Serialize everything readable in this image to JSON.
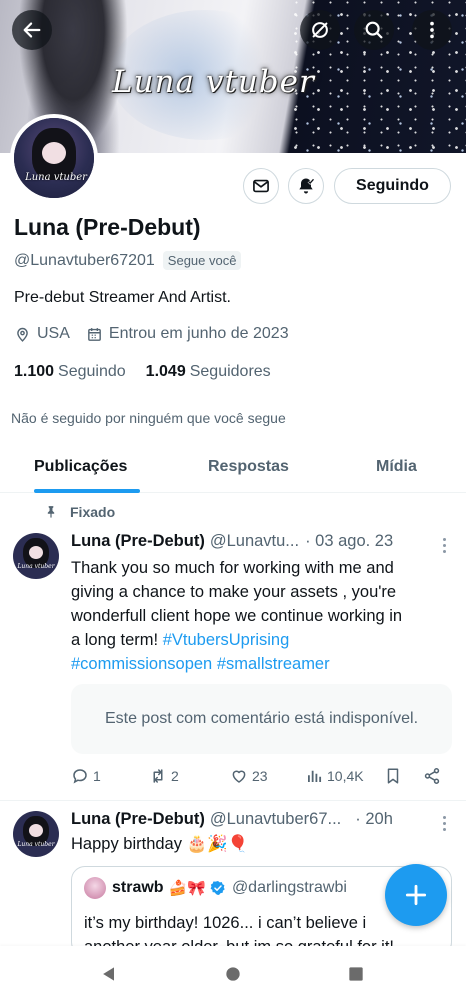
{
  "banner": {
    "title": "Luna vtuber"
  },
  "profile": {
    "name": "Luna (Pre-Debut)",
    "handle": "@Lunavtuber67201",
    "follows_you": "Segue você",
    "bio": "Pre-debut Streamer And Artist.",
    "location": "USA",
    "joined": "Entrou em junho de 2023",
    "following_count": "1.100",
    "following_label": "Seguindo",
    "followers_count": "1.049",
    "followers_label": "Seguidores",
    "not_followed_note": "Não é seguido por ninguém que você segue",
    "follow_button": "Seguindo",
    "avatar_text": "Luna vtuber"
  },
  "tabs": [
    {
      "label": "Publicações",
      "active": true
    },
    {
      "label": "Respostas",
      "active": false
    },
    {
      "label": "Mídia",
      "active": false
    }
  ],
  "posts": [
    {
      "pinned_label": "Fixado",
      "name": "Luna (Pre-Debut)",
      "handle": "@Lunavtu...",
      "date": "· 03 ago. 23",
      "text_lines": [
        "Thank you so much for working with me and",
        "giving a chance to make your assets , you're",
        "wonderfull client hope we continue working in",
        "a long term! "
      ],
      "hashtags": [
        "#VtubersUprising",
        "#commissionsopen",
        "#smallstreamer"
      ],
      "unavailable_text": "Este post com comentário está indisponível.",
      "replies": "1",
      "reposts": "2",
      "likes": "23",
      "views": "10,4K"
    },
    {
      "name": "Luna (Pre-Debut)",
      "handle": "@Lunavtuber67...",
      "date": "· 20h",
      "text": "Happy birthday 🎂🎉🎈",
      "quote": {
        "name": "strawb",
        "emoji": "🍰🎀",
        "handle": "@darlingstrawbi",
        "text_line1": "it’s my birthday! 1026... i can’t believe i",
        "text_line2": "another year older, but im so grateful for it!"
      }
    }
  ],
  "colors": {
    "accent": "#1d9bf0",
    "text_primary": "#0f1419",
    "text_secondary": "#536471",
    "border": "#cfd9de"
  },
  "icons": {
    "back": "back-arrow-icon",
    "grok": "grok-icon",
    "search": "search-icon",
    "more": "more-vertical-icon",
    "message": "envelope-icon",
    "notify": "bell-check-icon",
    "location": "location-pin-icon",
    "calendar": "calendar-icon",
    "pin": "pin-icon",
    "reply": "reply-icon",
    "repost": "repost-icon",
    "like": "heart-icon",
    "views": "views-icon",
    "bookmark": "bookmark-icon",
    "share": "share-icon",
    "compose": "plus-icon",
    "verified": "verified-badge-icon"
  }
}
